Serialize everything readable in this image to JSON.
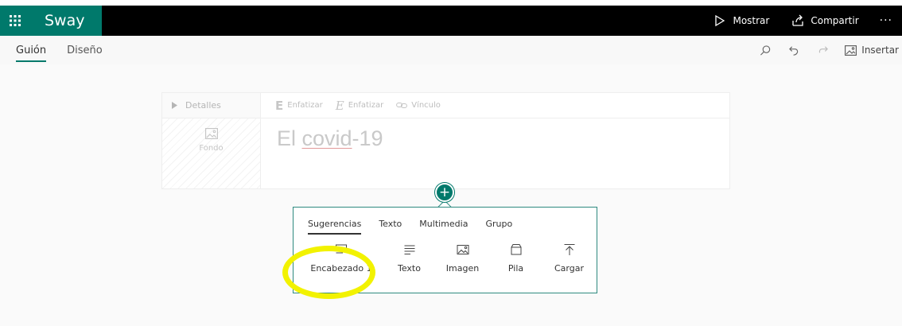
{
  "app": {
    "title": "Sway",
    "brand_color": "#00796b"
  },
  "topbar": {
    "show_label": "Mostrar",
    "share_label": "Compartir",
    "more_label": "···"
  },
  "subbar": {
    "tabs": [
      {
        "label": "Guión",
        "active": true
      },
      {
        "label": "Diseño",
        "active": false
      }
    ],
    "insert_label": "Insertar"
  },
  "card": {
    "details_label": "Detalles",
    "background_label": "Fondo",
    "format": {
      "emphasize_bold_label": "Enfatizar",
      "emphasize_italic_label": "Enfatizar",
      "link_label": "Vínculo"
    },
    "title_prefix": "El ",
    "title_underlined": "covid",
    "title_suffix": "-19"
  },
  "insert_panel": {
    "plus_label": "+",
    "tabs": [
      {
        "label": "Sugerencias",
        "active": true
      },
      {
        "label": "Texto",
        "active": false
      },
      {
        "label": "Multimedia",
        "active": false
      },
      {
        "label": "Grupo",
        "active": false
      }
    ],
    "items": [
      {
        "label": "Encabezado 1",
        "icon": "heading-icon"
      },
      {
        "label": "Texto",
        "icon": "text-icon"
      },
      {
        "label": "Imagen",
        "icon": "image-icon"
      },
      {
        "label": "Pila",
        "icon": "stack-icon"
      },
      {
        "label": "Cargar",
        "icon": "upload-icon"
      }
    ]
  },
  "annotation": {
    "highlight_color": "#f2f200"
  }
}
